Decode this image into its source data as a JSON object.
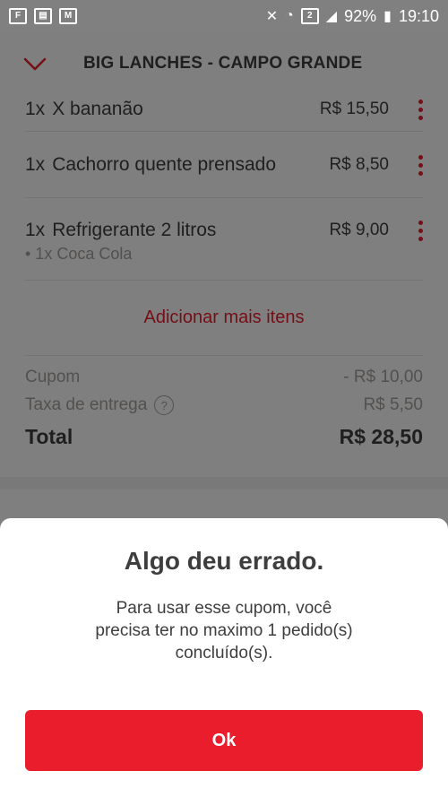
{
  "status_bar": {
    "battery": "92%",
    "time": "19:10",
    "sim_badge": "2"
  },
  "header": {
    "title": "BIG LANCHES - CAMPO GRANDE"
  },
  "items": [
    {
      "qty": "1x",
      "name": "X bananão",
      "price": "R$ 15,50"
    },
    {
      "qty": "1x",
      "name": "Cachorro quente prensado",
      "price": "R$ 8,50"
    },
    {
      "qty": "1x",
      "name": "Refrigerante 2 litros",
      "price": "R$ 9,00",
      "sub": "• 1x Coca Cola"
    }
  ],
  "add_more_label": "Adicionar mais itens",
  "summary": {
    "coupon_label": "Cupom",
    "coupon_value": "- R$ 10,00",
    "delivery_label": "Taxa de entrega",
    "delivery_help": "?",
    "delivery_value": "R$ 5,50",
    "total_label": "Total",
    "total_value": "R$ 28,50"
  },
  "dialog": {
    "title": "Algo deu errado.",
    "message": "Para usar esse cupom, você precisa ter no maximo 1 pedido(s) concluído(s).",
    "ok_label": "Ok"
  },
  "colors": {
    "accent": "#ea1d2c",
    "text": "#3f3e3e",
    "muted": "#a6a29f"
  }
}
